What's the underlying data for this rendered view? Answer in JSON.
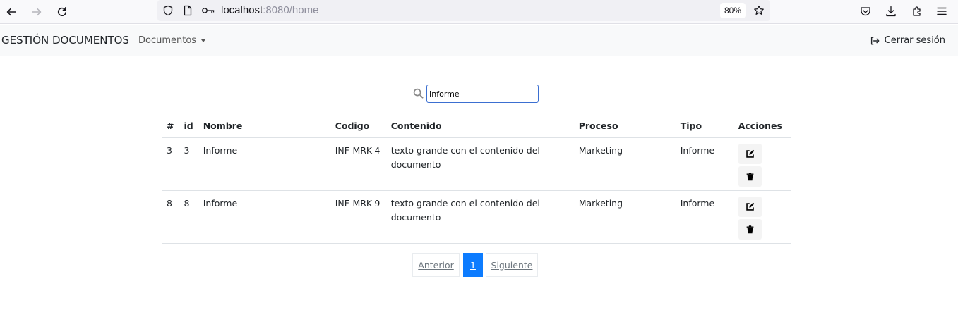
{
  "browser": {
    "url_host": "localhost",
    "url_rest": ":8080/home",
    "zoom": "80%"
  },
  "navbar": {
    "brand": "GESTIÓN DOCUMENTOS",
    "documents_menu": "Documentos",
    "logout": "Cerrar sesión"
  },
  "search": {
    "value": "Informe"
  },
  "table": {
    "headers": [
      "#",
      "id",
      "Nombre",
      "Codigo",
      "Contenido",
      "Proceso",
      "Tipo",
      "Acciones"
    ],
    "rows": [
      {
        "num": "3",
        "id": "3",
        "nombre": "Informe",
        "codigo": "INF-MRK-4",
        "contenido": "texto grande con el contenido del documento",
        "proceso": "Marketing",
        "tipo": "Informe"
      },
      {
        "num": "8",
        "id": "8",
        "nombre": "Informe",
        "codigo": "INF-MRK-9",
        "contenido": "texto grande con el contenido del documento",
        "proceso": "Marketing",
        "tipo": "Informe"
      }
    ]
  },
  "pagination": {
    "prev": "Anterior",
    "current": "1",
    "next": "Siguiente"
  },
  "icons": {
    "back": "back-arrow-icon",
    "forward": "forward-arrow-icon",
    "reload": "reload-icon",
    "shield": "shield-icon",
    "page": "page-icon",
    "key": "key-icon",
    "star": "star-icon",
    "pocket": "pocket-icon",
    "download": "download-icon",
    "extensions": "extensions-icon",
    "menu": "hamburger-menu-icon",
    "search": "search-icon",
    "logout": "logout-icon",
    "edit": "edit-icon",
    "delete": "trash-icon"
  },
  "colors": {
    "accent": "#0d7cff",
    "navbar_bg": "#f8f9fa",
    "search_border": "#3b6fd1"
  }
}
